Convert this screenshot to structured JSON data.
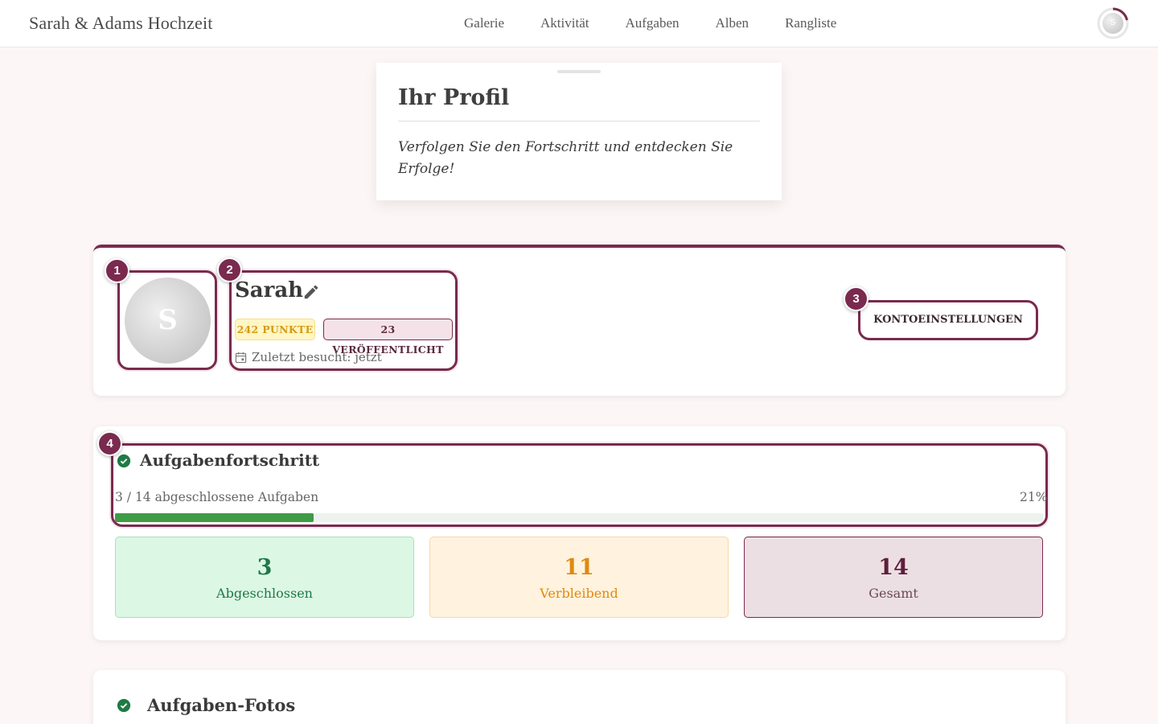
{
  "app": {
    "brand": "Sarah & Adams Hochzeit"
  },
  "nav": {
    "items": [
      "Galerie",
      "Aktivität",
      "Aufgaben",
      "Alben",
      "Rangliste"
    ]
  },
  "user_menu": {
    "initial": "S"
  },
  "header": {
    "title": "Ihr Profil",
    "subtitle": "Verfolgen Sie den Fortschritt und entdecken Sie Erfolge!"
  },
  "profile": {
    "avatar_initial": "S",
    "name": "Sarah",
    "points_badge": "242 PUNKTE",
    "published_badge": "23 VERÖFFENTLICHT",
    "last_visit": "Zuletzt besucht: jetzt",
    "settings_button": "KONTOEINSTELLUNGEN"
  },
  "markers": [
    "1",
    "2",
    "3",
    "4"
  ],
  "progress": {
    "title": "Aufgabenfortschritt",
    "summary": "3 / 14 abgeschlossene Aufgaben",
    "percent_label": "21%",
    "completed_fraction": 0.214,
    "stats": {
      "done": {
        "value": "3",
        "label": "Abgeschlossen"
      },
      "remaining": {
        "value": "11",
        "label": "Verbleibend"
      },
      "total": {
        "value": "14",
        "label": "Gesamt"
      }
    }
  },
  "photos": {
    "title": "Aufgaben-Fotos"
  },
  "colors": {
    "accent": "#7a2a4e",
    "success": "#3f9b46",
    "warning": "#e0890f"
  }
}
